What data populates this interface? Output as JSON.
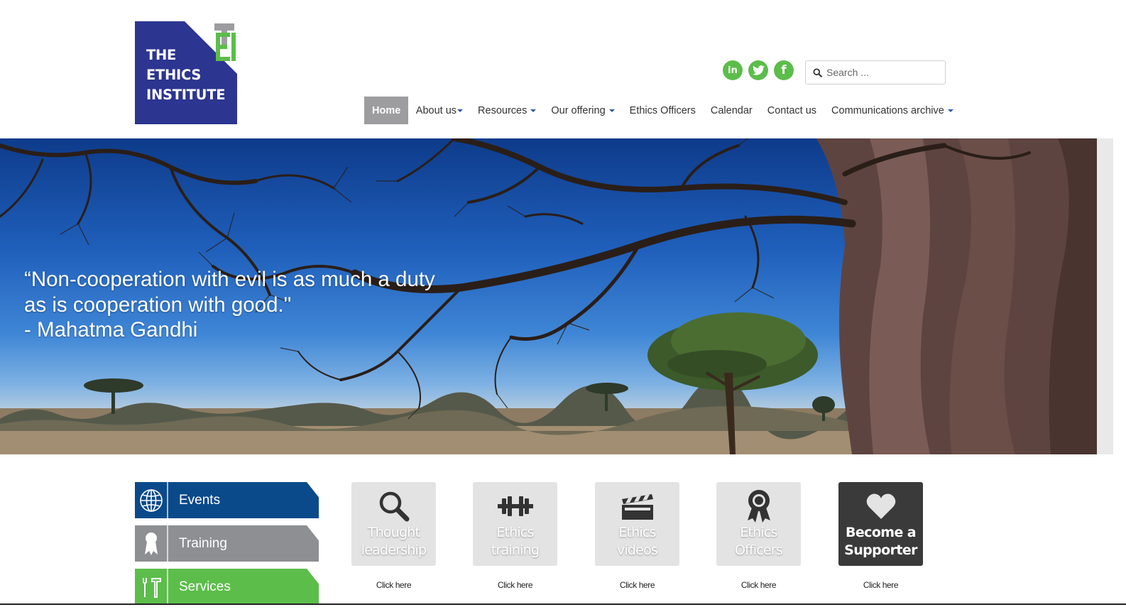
{
  "logo": {
    "line1": "THE",
    "line2": "ETHICS",
    "line3": "INSTITUTE",
    "mark_letters": "TEI"
  },
  "social": [
    {
      "icon": "linkedin-icon",
      "glyph": "in"
    },
    {
      "icon": "twitter-icon",
      "glyph": "t"
    },
    {
      "icon": "facebook-icon",
      "glyph": "f"
    }
  ],
  "search": {
    "placeholder": "Search ..."
  },
  "nav": [
    {
      "label": "Home",
      "active": true,
      "dropdown": false
    },
    {
      "label": "About us",
      "active": false,
      "dropdown": true
    },
    {
      "label": "Resources",
      "active": false,
      "dropdown": true
    },
    {
      "label": "Our offering",
      "active": false,
      "dropdown": true
    },
    {
      "label": "Ethics Officers",
      "active": false,
      "dropdown": false
    },
    {
      "label": "Calendar",
      "active": false,
      "dropdown": false
    },
    {
      "label": "Contact us",
      "active": false,
      "dropdown": false
    },
    {
      "label": "Communications archive",
      "active": false,
      "dropdown": true
    }
  ],
  "hero": {
    "quote_line1": "“Non-cooperation with evil is as much a duty",
    "quote_line2": "as is cooperation with good.\"",
    "quote_author": "- Mahatma Gandhi"
  },
  "side_buttons": [
    {
      "label": "Events",
      "icon": "globe-icon"
    },
    {
      "label": "Training",
      "icon": "award-ribbon-icon"
    },
    {
      "label": "Services",
      "icon": "tools-icon"
    }
  ],
  "tiles": [
    {
      "line1": "Thought",
      "line2": "leadership",
      "icon": "magnifier-icon",
      "link": "Click here"
    },
    {
      "line1": "Ethics",
      "line2": "training",
      "icon": "dumbbell-icon",
      "link": "Click here"
    },
    {
      "line1": "Ethics",
      "line2": "videos",
      "icon": "clapperboard-icon",
      "link": "Click here"
    },
    {
      "line1": "Ethics",
      "line2": "Officers",
      "icon": "medal-icon",
      "link": "Click here"
    },
    {
      "line1": "Become a",
      "line2": "Supporter",
      "icon": "heart-icon",
      "link": "Click here"
    }
  ],
  "colors": {
    "brand_blue": "#2c3590",
    "brand_green": "#5cbd4a",
    "events_blue": "#0b4a8a",
    "nav_active": "#9d9d9f",
    "tile_gray": "#e3e3e3",
    "tile_dark": "#3a3a3a"
  }
}
